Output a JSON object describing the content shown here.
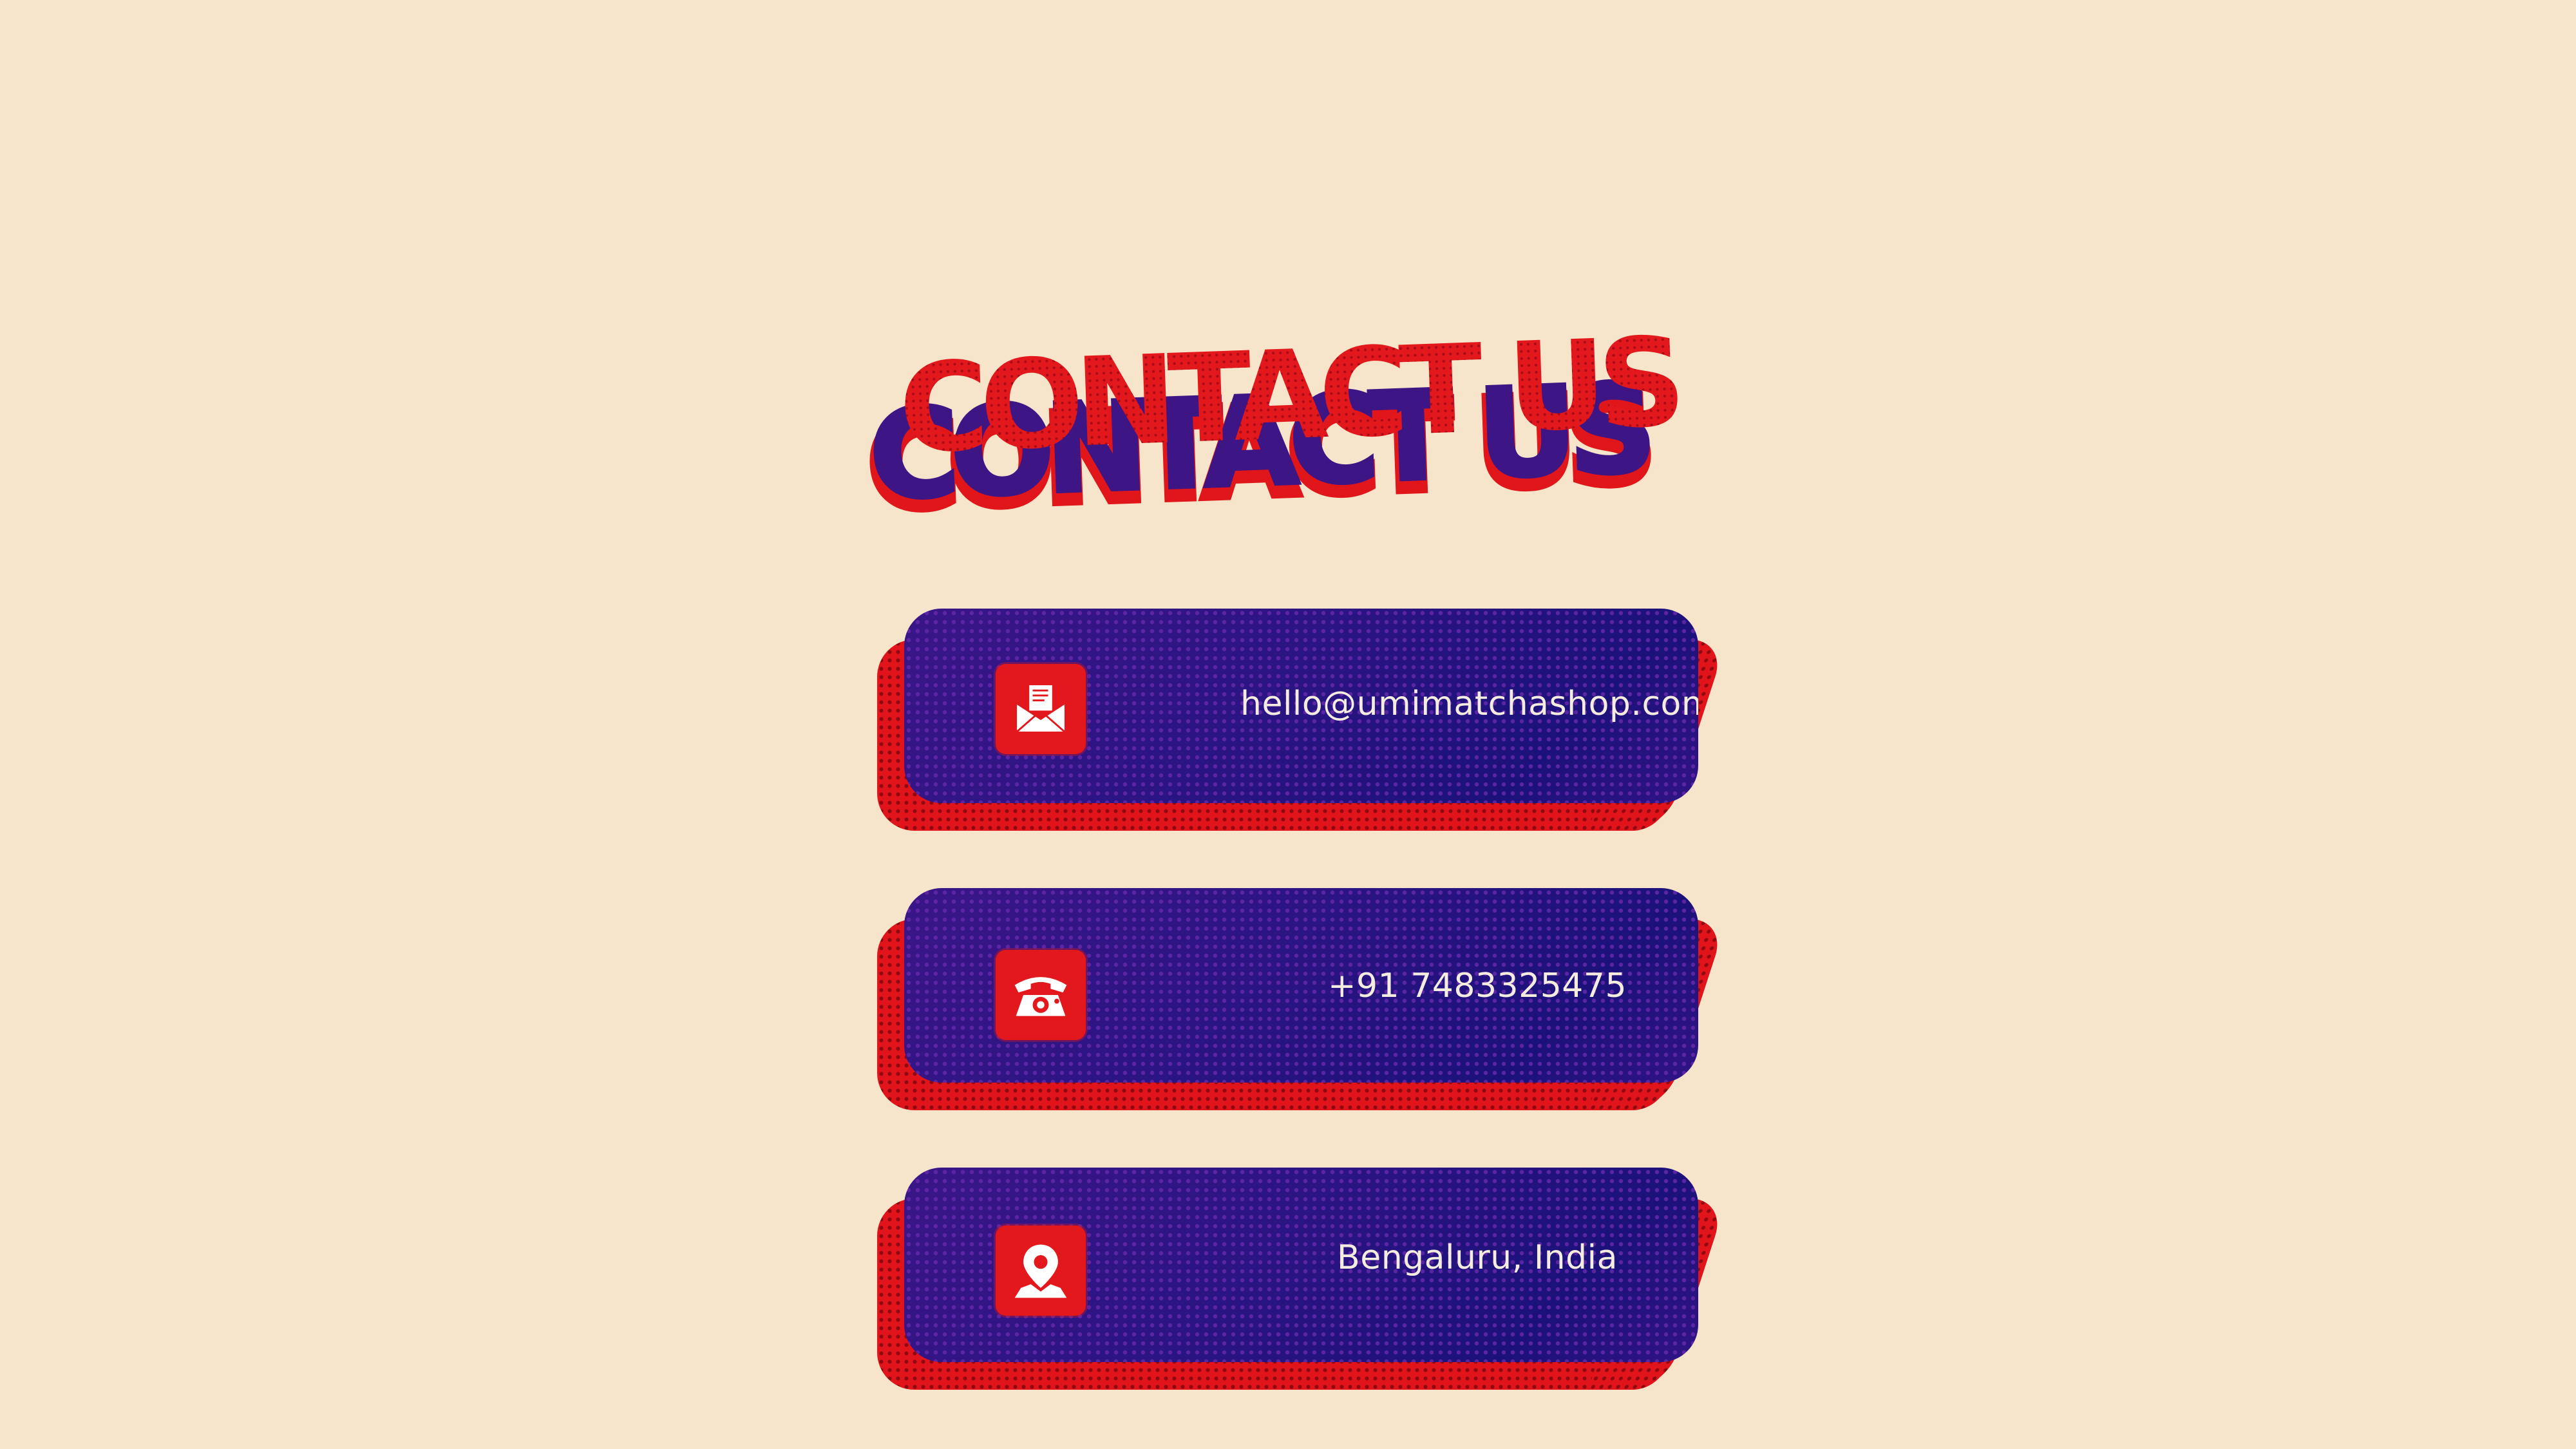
{
  "title": "CONTACT US",
  "colors": {
    "background": "#f6e5ca",
    "accent_red": "#e3181c",
    "card_purple": "#2a1480",
    "card_text": "#f4ecdf"
  },
  "contacts": [
    {
      "icon": "envelope-icon",
      "text": "hello@umimatchashop.com"
    },
    {
      "icon": "telephone-icon",
      "text": "+91 7483325475"
    },
    {
      "icon": "location-pin-icon",
      "text": "Bengaluru, India"
    }
  ]
}
